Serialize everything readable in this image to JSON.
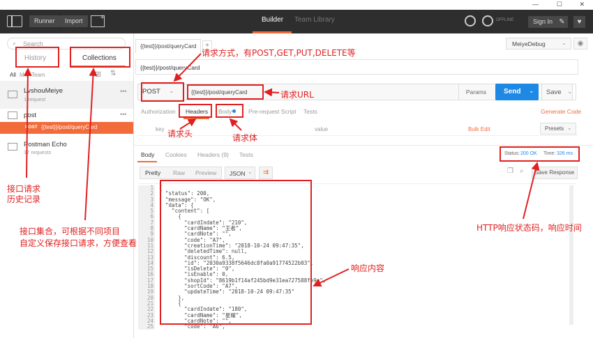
{
  "titlebar": {
    "minimize": "—",
    "maximize": "☐",
    "close": "✕"
  },
  "toolbar": {
    "runner": "Runner",
    "import": "Import",
    "builder": "Builder",
    "team_library": "Team Library",
    "offline": "OFFLINE",
    "sign_in": "Sign In"
  },
  "sidebar": {
    "search_placeholder": "Search",
    "tab_history": "History",
    "tab_collections": "Collections",
    "filters": {
      "all": "All",
      "me": "Me",
      "team": "Team"
    },
    "collections": [
      {
        "name": "LvshouMeiye",
        "count": "1 request"
      },
      {
        "name": "post",
        "count": ""
      },
      {
        "name": "Postman Echo",
        "count": "37 requests"
      }
    ],
    "active_request": {
      "method": "POST",
      "url": "{{test}}/post/queryCard"
    }
  },
  "main": {
    "tab_label": "{{test}}/post/queryCard",
    "add_tab": "+",
    "environment": "MeiyeDebug",
    "request_name": "{{test}}/post/queryCard",
    "method": "POST",
    "url": "{{test}}/post/queryCard",
    "params": "Params",
    "send": "Send",
    "save": "Save",
    "req_tabs": {
      "authorization": "Authorization",
      "headers": "Headers",
      "body": "Body",
      "pre_request": "Pre-request Script",
      "tests": "Tests",
      "generate_code": "Generate Code"
    },
    "header_row": {
      "key": "key",
      "value": "value",
      "bulk_edit": "Bulk Edit",
      "presets": "Presets"
    },
    "resp_tabs": {
      "body": "Body",
      "cookies": "Cookies",
      "headers": "Headers (9)",
      "tests": "Tests"
    },
    "status_label": "Status:",
    "status_value": "200 OK",
    "time_label": "Time:",
    "time_value": "326 ms",
    "view": {
      "pretty": "Pretty",
      "raw": "Raw",
      "preview": "Preview",
      "format": "JSON",
      "save_response": "Save Response"
    }
  },
  "response_lines": [
    "{",
    "  \"status\": 200,",
    "  \"message\": \"OK\",",
    "  \"data\": {",
    "    \"content\": [",
    "      {",
    "        \"cardIndate\": \"210\",",
    "        \"cardName\": \"王者\",",
    "        \"cardNote\": \"\",",
    "        \"code\": \"A7\",",
    "        \"creationTime\": \"2018-10-24 09:47:35\",",
    "        \"deletedTime\": null,",
    "        \"discount\": 6.5,",
    "        \"id\": \"2030a9338f5646dc8fa0a91774522b03\",",
    "        \"isDelete\": \"0\",",
    "        \"isEnable\": 0,",
    "        \"shopId\": \"8619b1f14af245bd9e31ea727588fe9e\",",
    "        \"sortCode\": \"A7\",",
    "        \"updateTime\": \"2018-10-24 09:47:35\"",
    "      },",
    "      {",
    "        \"cardIndate\": \"180\",",
    "        \"cardName\": \"星耀\",",
    "        \"cardNote\": \"\",",
    "        \"code\": \"A6\","
  ],
  "line_numbers": [
    "1",
    "2",
    "3",
    "4",
    "5",
    "6",
    "7",
    "8",
    "9",
    "10",
    "11",
    "12",
    "13",
    "14",
    "15",
    "16",
    "17",
    "18",
    "19",
    "20",
    "21",
    "22",
    "23",
    "24",
    "25"
  ],
  "annotations": {
    "method": "请求方式，有POST,GET,PUT,DELETE等",
    "url": "请求URL",
    "headers": "请求头",
    "body": "请求体",
    "history": "接口请求\n历史记录",
    "collections": "接口集合，可根据不同项目\n自定义保存接口请求，方便查看",
    "status": "HTTP响应状态码，响应时间",
    "response": "响应内容"
  }
}
